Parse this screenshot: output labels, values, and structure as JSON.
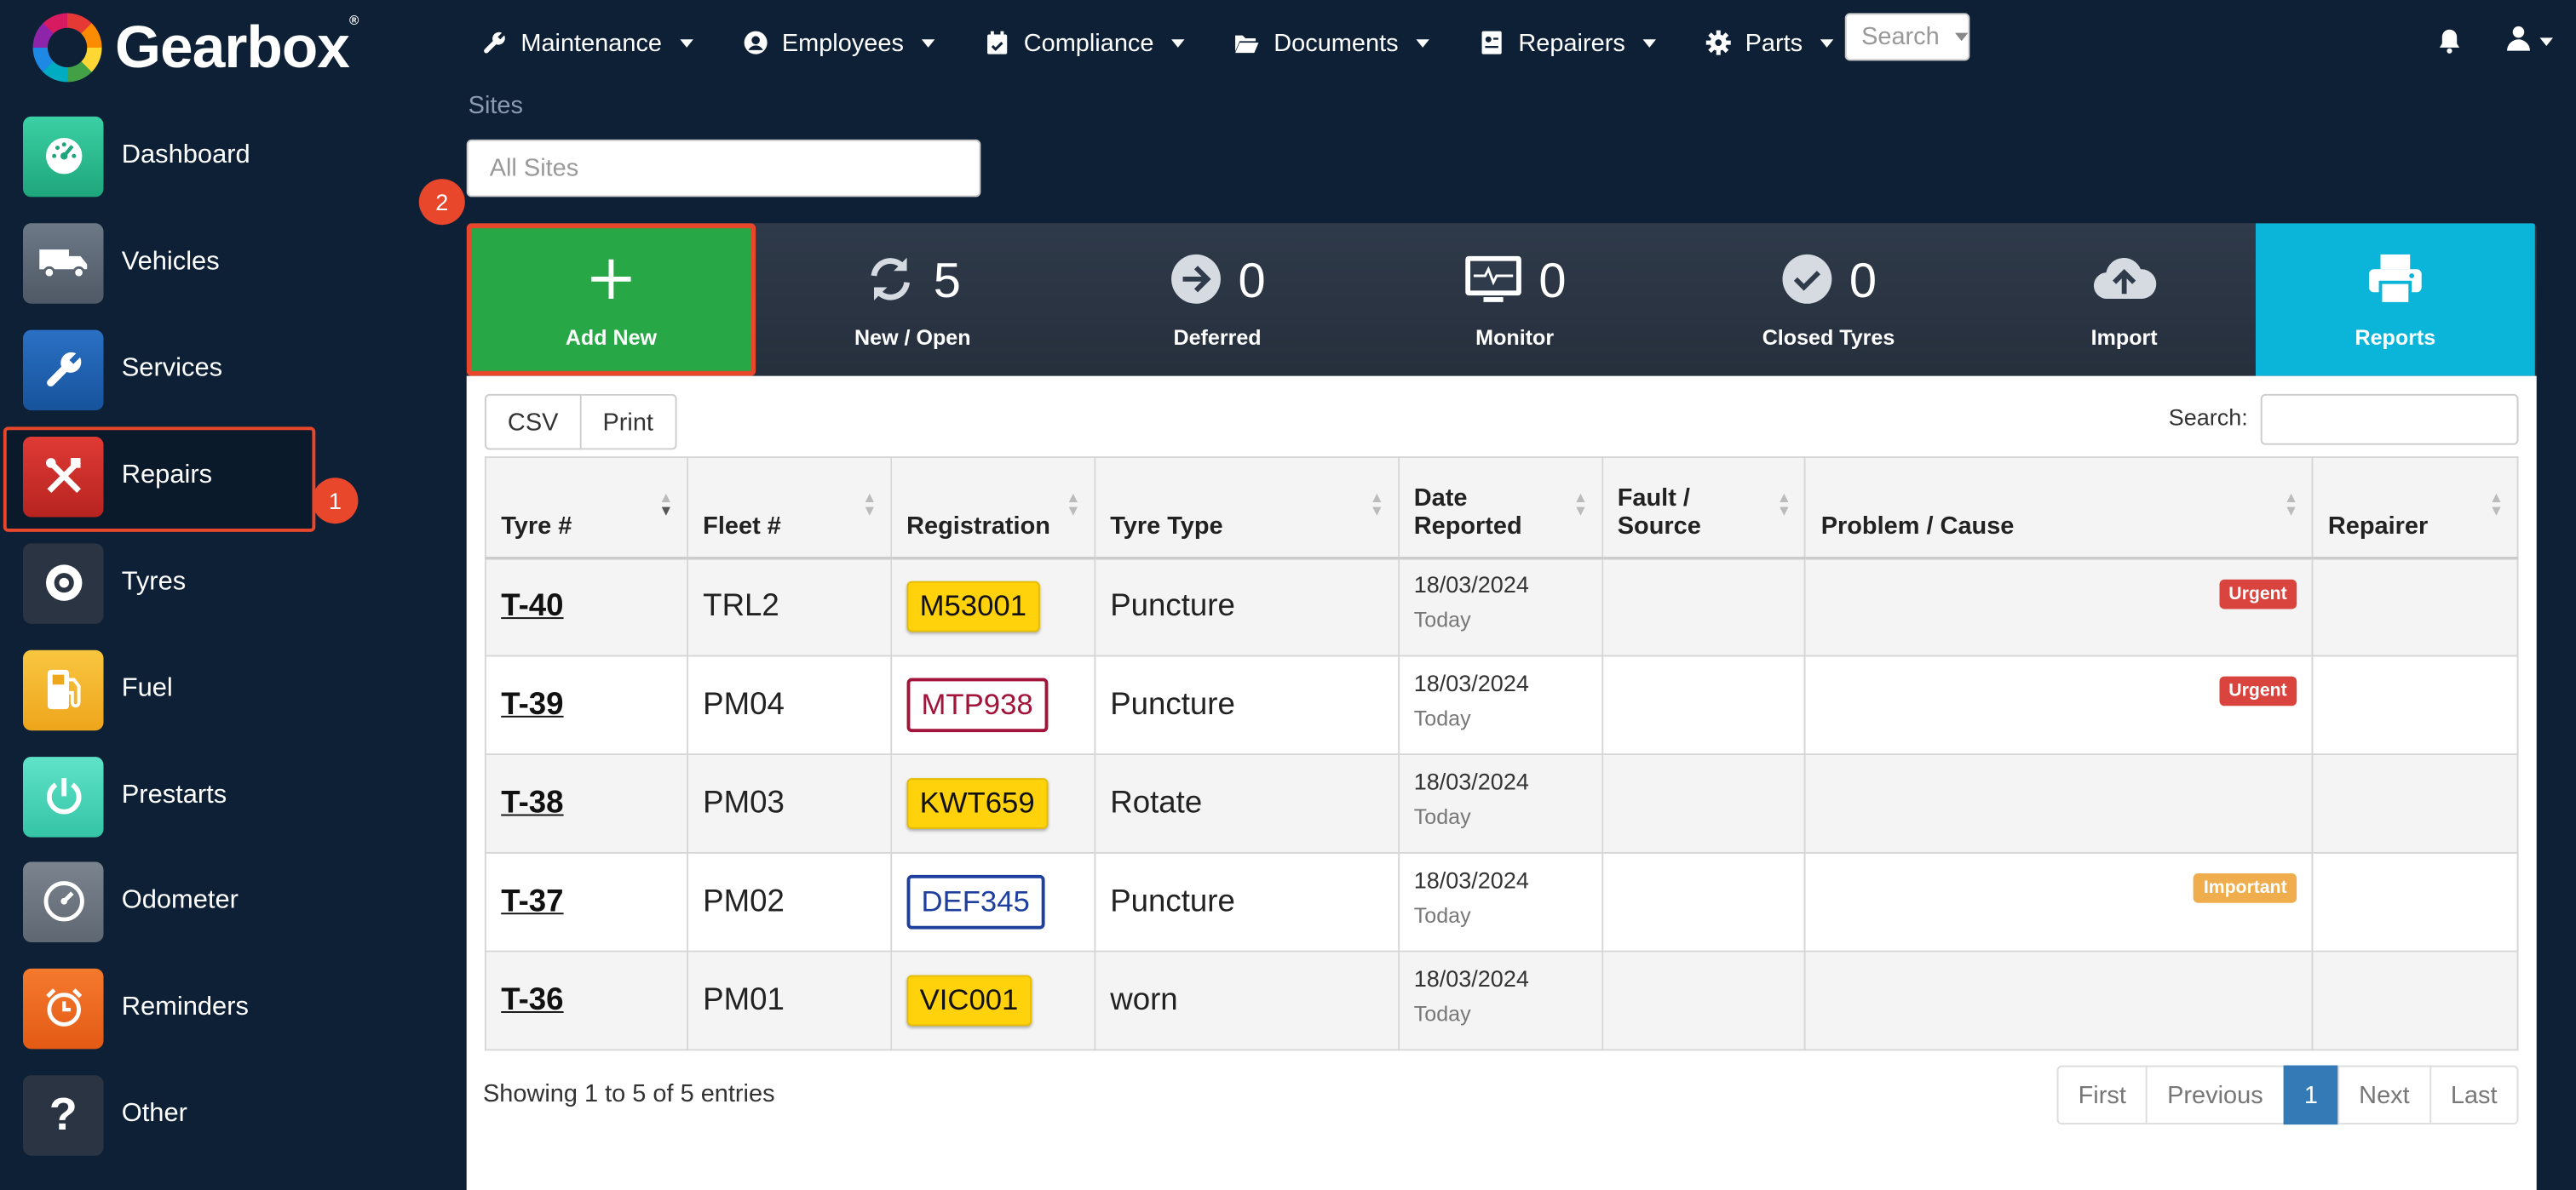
{
  "brand": {
    "name": "Gearbox",
    "mark": "®"
  },
  "topnav": [
    {
      "label": "Maintenance",
      "icon": "wrench-icon"
    },
    {
      "label": "Employees",
      "icon": "user-circle-icon"
    },
    {
      "label": "Compliance",
      "icon": "calendar-check-icon"
    },
    {
      "label": "Documents",
      "icon": "folder-open-icon"
    },
    {
      "label": "Repairers",
      "icon": "id-card-icon"
    },
    {
      "label": "Parts",
      "icon": "gear-icon"
    }
  ],
  "search_dropdown": {
    "label": "Search"
  },
  "sidebar": {
    "items": [
      {
        "label": "Dashboard",
        "icon": "gauge-icon",
        "color": "#2bbf8f"
      },
      {
        "label": "Vehicles",
        "icon": "truck-icon",
        "color": "#5e6a78"
      },
      {
        "label": "Services",
        "icon": "wrench-icon",
        "color": "#1f5fb0"
      },
      {
        "label": "Repairs",
        "icon": "tools-icon",
        "color": "#d0312d"
      },
      {
        "label": "Tyres",
        "icon": "tyre-icon",
        "color": "#26303d"
      },
      {
        "label": "Fuel",
        "icon": "fuel-pump-icon",
        "color": "#f5b82e"
      },
      {
        "label": "Prestarts",
        "icon": "power-icon",
        "color": "#46d6b9"
      },
      {
        "label": "Odometer",
        "icon": "odometer-icon",
        "color": "#6c7480"
      },
      {
        "label": "Reminders",
        "icon": "alarm-clock-icon",
        "color": "#ef6a1f"
      },
      {
        "label": "Other",
        "icon": "question-icon",
        "color": "#2b3442"
      }
    ],
    "active": "Tyres"
  },
  "annotations": {
    "one": "1",
    "two": "2"
  },
  "sites": {
    "label": "Sites",
    "placeholder": "All Sites"
  },
  "stats": {
    "add_new": {
      "label": "Add New"
    },
    "new_open": {
      "label": "New / Open",
      "count": "5"
    },
    "deferred": {
      "label": "Deferred",
      "count": "0"
    },
    "monitor": {
      "label": "Monitor",
      "count": "0"
    },
    "closed": {
      "label": "Closed Tyres",
      "count": "0"
    },
    "import": {
      "label": "Import"
    },
    "reports": {
      "label": "Reports"
    }
  },
  "toolbar": {
    "csv": "CSV",
    "print": "Print",
    "search_label": "Search:"
  },
  "table": {
    "headers": [
      "Tyre #",
      "Fleet #",
      "Registration",
      "Tyre Type",
      "Date Reported",
      "Fault / Source",
      "Problem / Cause",
      "Repairer"
    ],
    "header_lines": {
      "date": [
        "Date",
        "Reported"
      ],
      "fault": [
        "Fault /",
        "Source"
      ]
    },
    "rows": [
      {
        "tyre": "T-40",
        "fleet": "TRL2",
        "reg": "M53001",
        "plate": "yellow",
        "type": "Puncture",
        "date": "18/03/2024",
        "when": "Today",
        "priority": "Urgent"
      },
      {
        "tyre": "T-39",
        "fleet": "PM04",
        "reg": "MTP938",
        "plate": "red",
        "type": "Puncture",
        "date": "18/03/2024",
        "when": "Today",
        "priority": "Urgent"
      },
      {
        "tyre": "T-38",
        "fleet": "PM03",
        "reg": "KWT659",
        "plate": "yellow",
        "type": "Rotate",
        "date": "18/03/2024",
        "when": "Today",
        "priority": ""
      },
      {
        "tyre": "T-37",
        "fleet": "PM02",
        "reg": "DEF345",
        "plate": "blue",
        "type": "Puncture",
        "date": "18/03/2024",
        "when": "Today",
        "priority": "Important"
      },
      {
        "tyre": "T-36",
        "fleet": "PM01",
        "reg": "VIC001",
        "plate": "yellow",
        "type": "worn",
        "date": "18/03/2024",
        "when": "Today",
        "priority": ""
      }
    ]
  },
  "footer": {
    "showing": "Showing 1 to 5 of 5 entries",
    "pager": {
      "first": "First",
      "previous": "Previous",
      "current": "1",
      "next": "Next",
      "last": "Last"
    }
  }
}
